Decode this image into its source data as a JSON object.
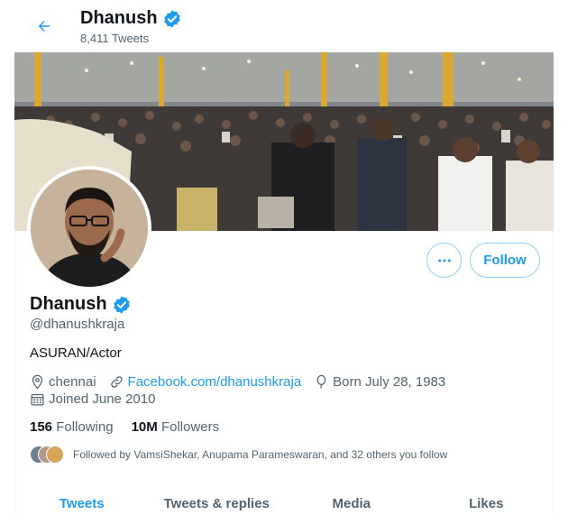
{
  "header": {
    "name": "Dhanush",
    "tweet_count": "8,411 Tweets",
    "back_icon": "arrow-left-icon"
  },
  "profile": {
    "name": "Dhanush",
    "verified_icon": "verified-badge-icon",
    "handle": "@dhanushkraja",
    "bio": "ASURAN/Actor",
    "location": "chennai",
    "website": "Facebook.com/dhanushkraja",
    "birthday": "Born July 28, 1983",
    "joined": "Joined June 2010"
  },
  "actions": {
    "more_icon": "more-dots-icon",
    "follow_label": "Follow"
  },
  "stats": {
    "following_count": "156",
    "following_label": "Following",
    "followers_count": "10M",
    "followers_label": "Followers"
  },
  "followed_by": "Followed by VamsiShekar, Anupama Parameswaran, and 32 others you follow",
  "tabs": [
    {
      "label": "Tweets",
      "active": true
    },
    {
      "label": "Tweets & replies",
      "active": false
    },
    {
      "label": "Media",
      "active": false
    },
    {
      "label": "Likes",
      "active": false
    }
  ],
  "colors": {
    "accent": "#1d9bf0",
    "text_primary": "#0f1419",
    "text_secondary": "#536471"
  }
}
